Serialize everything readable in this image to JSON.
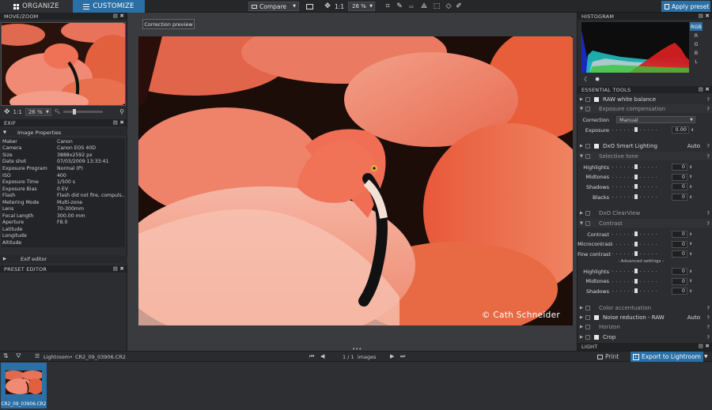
{
  "tabs": {
    "organize": "ORGANIZE",
    "customize": "CUSTOMIZE"
  },
  "toolbar": {
    "compare": "Compare",
    "zoom_ratio": "1:1",
    "zoom_percent": "26 %",
    "apply_preset": "Apply preset"
  },
  "left": {
    "move_zoom": "MOVE/ZOOM",
    "zoom_ratio": "1:1",
    "zoom_percent": "26 %",
    "exif": "EXIF",
    "image_properties": "Image Properties",
    "exif_rows": [
      {
        "k": "Maker",
        "v": "Canon"
      },
      {
        "k": "Camera",
        "v": "Canon EOS 40D"
      },
      {
        "k": "Size",
        "v": "3888x2592 px"
      },
      {
        "k": "Date shot",
        "v": "07/03/2009 13:33:41"
      },
      {
        "k": "Exposure Program",
        "v": "Normal (P)"
      },
      {
        "k": "ISO",
        "v": "400"
      },
      {
        "k": "Exposure Time",
        "v": "1/500 s"
      },
      {
        "k": "Exposure Bias",
        "v": "0 EV"
      },
      {
        "k": "Flash",
        "v": "Flash did not fire, compuls..."
      },
      {
        "k": "Metering Mode",
        "v": "Multi-zone"
      },
      {
        "k": "Lens",
        "v": "70-300mm"
      },
      {
        "k": "Focal Length",
        "v": "300.00 mm"
      },
      {
        "k": "Aperture",
        "v": "F8.0"
      },
      {
        "k": "Latitude",
        "v": ""
      },
      {
        "k": "Longitude",
        "v": ""
      },
      {
        "k": "Altitude",
        "v": ""
      }
    ],
    "exif_editor": "Exif editor",
    "preset_editor": "PRESET EDITOR"
  },
  "center": {
    "correction_preview": "Correction preview",
    "copyright": "© Cath Schneider"
  },
  "right": {
    "histogram": "HISTOGRAM",
    "channels": [
      "RGB",
      "R",
      "G",
      "B",
      "L"
    ],
    "essential_tools": "ESSENTIAL TOOLS",
    "raw_wb": "RAW white balance",
    "exposure_comp": "Exposure compensation",
    "correction_label": "Correction",
    "correction_value": "Manual",
    "exposure_label": "Exposure",
    "exposure_value": "0.00",
    "smart_lighting": "DxO Smart Lighting",
    "smart_lighting_mode": "Auto",
    "selective_tone": "Selective tone",
    "tone": [
      {
        "label": "Highlights",
        "value": "0"
      },
      {
        "label": "Midtones",
        "value": "0"
      },
      {
        "label": "Shadows",
        "value": "0"
      },
      {
        "label": "Blacks",
        "value": "0"
      }
    ],
    "clearview": "DxO ClearView",
    "contrast": "Contrast",
    "contrast_rows": [
      {
        "label": "Contrast",
        "value": "0"
      },
      {
        "label": "Microcontrast",
        "value": "0"
      },
      {
        "label": "Fine contrast",
        "value": "0"
      }
    ],
    "advanced_settings": "- Advanced settings -",
    "adv_rows": [
      {
        "label": "Highlights",
        "value": "0"
      },
      {
        "label": "Midtones",
        "value": "0"
      },
      {
        "label": "Shadows",
        "value": "0"
      }
    ],
    "color_accentuation": "Color accentuation",
    "noise_reduction": "Noise reduction - RAW",
    "noise_mode": "Auto",
    "horizon": "Horizon",
    "crop": "Crop",
    "light": "LIGHT"
  },
  "bottom": {
    "source": "Lightroom",
    "file": "CR2_09_03906.CR2",
    "pager": "1 / 1  images",
    "print": "Print",
    "export": "Export to Lightroom",
    "thumb_name": "CR2_09_03906.CR2"
  }
}
